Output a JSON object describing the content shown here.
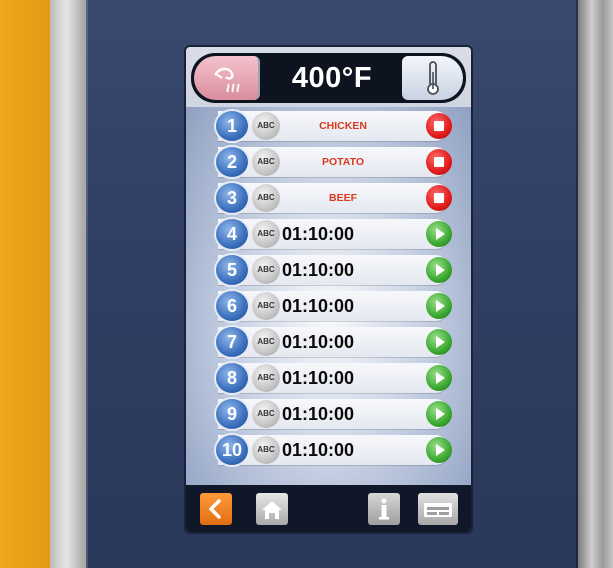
{
  "header": {
    "temperature": "400°F",
    "steam_icon": "steam-icon",
    "thermometer_icon": "thermometer-icon"
  },
  "rows": [
    {
      "number": "1",
      "abc": "ABC",
      "label": "CHICKEN",
      "action": "stop"
    },
    {
      "number": "2",
      "abc": "ABC",
      "label": "POTATO",
      "action": "stop"
    },
    {
      "number": "3",
      "abc": "ABC",
      "label": "BEEF",
      "action": "stop"
    },
    {
      "number": "4",
      "abc": "ABC",
      "time": "01:10:00",
      "action": "play"
    },
    {
      "number": "5",
      "abc": "ABC",
      "time": "01:10:00",
      "action": "play"
    },
    {
      "number": "6",
      "abc": "ABC",
      "time": "01:10:00",
      "action": "play"
    },
    {
      "number": "7",
      "abc": "ABC",
      "time": "01:10:00",
      "action": "play"
    },
    {
      "number": "8",
      "abc": "ABC",
      "time": "01:10:00",
      "action": "play"
    },
    {
      "number": "9",
      "abc": "ABC",
      "time": "01:10:00",
      "action": "play"
    },
    {
      "number": "10",
      "abc": "ABC",
      "time": "01:10:00",
      "action": "play"
    }
  ],
  "footer": {
    "back_icon": "chevron-left-icon",
    "home_icon": "home-icon",
    "info_icon": "info-icon",
    "tray_icon": "tray-icon"
  },
  "colors": {
    "label_red": "#d73a1f",
    "stop_red": "#e21b1b",
    "play_green": "#3aa82f",
    "badge_blue": "#3a6fbd",
    "back_orange": "#e06f12"
  }
}
